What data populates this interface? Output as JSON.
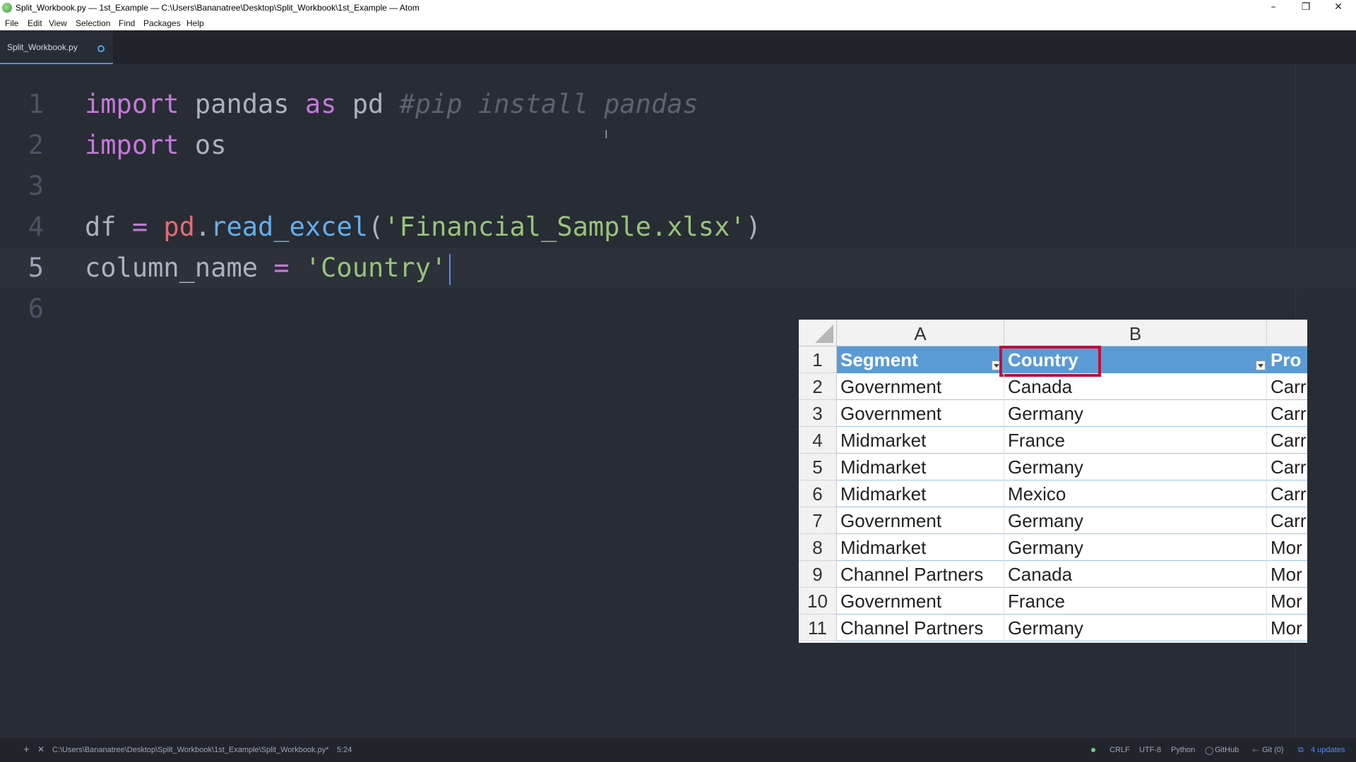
{
  "window": {
    "title": "Split_Workbook.py — 1st_Example — C:\\Users\\Bananatree\\Desktop\\Split_Workbook\\1st_Example — Atom",
    "minimize": "–",
    "maximize": "❐",
    "close": "✕"
  },
  "menu": [
    "File",
    "Edit",
    "View",
    "Selection",
    "Find",
    "Packages",
    "Help"
  ],
  "tab": {
    "label": "Split_Workbook.py"
  },
  "editor": {
    "lines": [
      {
        "num": "1",
        "t": [
          {
            "k": "kw",
            "v": "import"
          },
          {
            "k": "pl",
            "v": " pandas "
          },
          {
            "k": "kw",
            "v": "as"
          },
          {
            "k": "pl",
            "v": " pd "
          },
          {
            "k": "cmt",
            "v": "#pip install pandas"
          }
        ]
      },
      {
        "num": "2",
        "t": [
          {
            "k": "kw",
            "v": "import"
          },
          {
            "k": "pl",
            "v": " os"
          }
        ]
      },
      {
        "num": "3",
        "t": []
      },
      {
        "num": "4",
        "t": [
          {
            "k": "pl",
            "v": "df "
          },
          {
            "k": "op",
            "v": "="
          },
          {
            "k": "pl",
            "v": " "
          },
          {
            "k": "var",
            "v": "pd"
          },
          {
            "k": "pl",
            "v": "."
          },
          {
            "k": "fn",
            "v": "read_excel"
          },
          {
            "k": "pl",
            "v": "("
          },
          {
            "k": "str",
            "v": "'Financial_Sample.xlsx'"
          },
          {
            "k": "pl",
            "v": ")"
          }
        ]
      },
      {
        "num": "5",
        "t": [
          {
            "k": "pl",
            "v": "column_name "
          },
          {
            "k": "op",
            "v": "="
          },
          {
            "k": "pl",
            "v": " "
          },
          {
            "k": "str",
            "v": "'Country'"
          }
        ]
      },
      {
        "num": "6",
        "t": []
      }
    ]
  },
  "spreadsheet": {
    "columns": [
      "A",
      "B",
      ""
    ],
    "header_row": {
      "num": "1",
      "cells": [
        "Segment",
        "Country",
        "Pro"
      ]
    },
    "rows": [
      {
        "num": "2",
        "cells": [
          "Government",
          "Canada",
          "Carr"
        ]
      },
      {
        "num": "3",
        "cells": [
          "Government",
          "Germany",
          "Carr"
        ]
      },
      {
        "num": "4",
        "cells": [
          "Midmarket",
          "France",
          "Carr"
        ]
      },
      {
        "num": "5",
        "cells": [
          "Midmarket",
          "Germany",
          "Carr"
        ]
      },
      {
        "num": "6",
        "cells": [
          "Midmarket",
          "Mexico",
          "Carr"
        ]
      },
      {
        "num": "7",
        "cells": [
          "Government",
          "Germany",
          "Carr"
        ]
      },
      {
        "num": "8",
        "cells": [
          "Midmarket",
          "Germany",
          "Mor"
        ]
      },
      {
        "num": "9",
        "cells": [
          "Channel Partners",
          "Canada",
          "Mor"
        ]
      },
      {
        "num": "10",
        "cells": [
          "Government",
          "France",
          "Mor"
        ]
      },
      {
        "num": "11",
        "cells": [
          "Channel Partners",
          "Germany",
          "Mor"
        ]
      }
    ],
    "highlight_color": "#c0103a",
    "header_color": "#5b9bd5"
  },
  "status": {
    "add": "+",
    "close": "✕",
    "path": "C:\\Users\\Bananatree\\Desktop\\Split_Workbook\\1st_Example\\Split_Workbook.py*",
    "cursor": "5:24",
    "line_ending": "CRLF",
    "encoding": "UTF-8",
    "grammar": "Python",
    "github": "GitHub",
    "git": "Git (0)",
    "updates": "4 updates"
  }
}
